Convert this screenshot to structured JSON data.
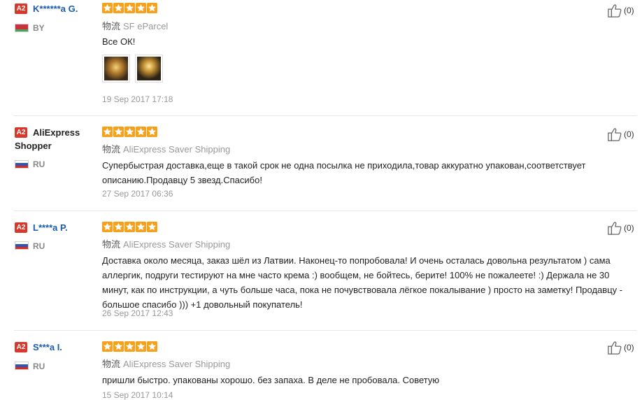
{
  "colors": {
    "star": "#f5a21a",
    "badge": "#d8372c",
    "link": "#1a5bb0"
  },
  "shipping_prefix": "物流",
  "reviews": [
    {
      "badge": "A2",
      "user": "K******a G.",
      "flag": "belarus",
      "country": "BY",
      "stars": 5,
      "shipping": "SF eParcel",
      "text": "Все ОК!",
      "photos": 2,
      "date": "19 Sep 2017 17:18",
      "helpful": "(0)"
    },
    {
      "badge": "A2",
      "user": "AliExpress Shopper",
      "flag": "russia",
      "country": "RU",
      "stars": 5,
      "shipping": "AliExpress Saver Shipping",
      "text": "Супербыстрая доставка,еще в такой срок не одна посылка не приходила,товар аккуратно упакован,соответствует описанию.Продавцу 5 звезд.Спасибо!",
      "date": "27 Sep 2017 06:36",
      "helpful": "(0)"
    },
    {
      "badge": "A2",
      "user": "L****a P.",
      "flag": "russia",
      "country": "RU",
      "stars": 5,
      "shipping": "AliExpress Saver Shipping",
      "text": "Доставка около месяца, заказ шёл из Латвии. Наконец-то попробовала! И очень осталась довольна результатом ) сама аллергик, подруги тестируют на мне часто крема :) вообщем, не бойтесь, берите! 100% не пожалеете! :) Держала не 30 минут, как по инструкции, а чуть больше часа, пока не почувствовала лёгкое покалывание ) просто на заметку! Продавцу - большое спасибо ))) +1 довольный покупатель!",
      "date": "26 Sep 2017 12:43",
      "helpful": "(0)"
    },
    {
      "badge": "A2",
      "user": "S***a I.",
      "flag": "russia",
      "country": "RU",
      "stars": 5,
      "shipping": "AliExpress Saver Shipping",
      "text": "пришли быстро. упакованы хорошо. без запаха. В деле не пробовала. Советую",
      "date": "15 Sep 2017 10:14",
      "helpful": "(0)"
    }
  ]
}
